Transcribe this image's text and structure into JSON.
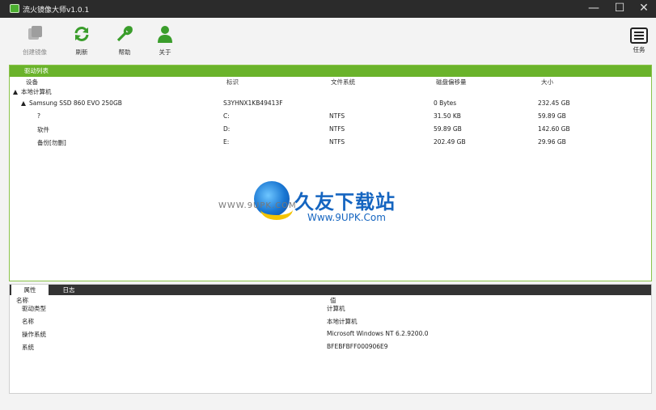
{
  "window": {
    "title": "流火镜像大师v1.0.1",
    "minimize": "—",
    "maximize": "☐",
    "close": "✕"
  },
  "toolbar": {
    "create_image": "创建镜像",
    "refresh": "刷新",
    "help": "帮助",
    "about": "关于",
    "tasks": "任务"
  },
  "drives": {
    "panel_title": "驱动列表",
    "columns": {
      "device": "设备",
      "label": "标识",
      "filesystem": "文件系统",
      "free": "磁盘偏移量",
      "size": "大小"
    },
    "computer": "本地计算机",
    "disk": {
      "name": "Samsung SSD 860 EVO 250GB",
      "label": "S3YHNX1KB49413F",
      "filesystem": "",
      "free": "0 Bytes",
      "size": "232.45 GB"
    },
    "partitions": [
      {
        "name": "?",
        "label": "C:",
        "filesystem": "NTFS",
        "free": "31.50 KB",
        "size": "59.89 GB"
      },
      {
        "name": "软件",
        "label": "D:",
        "filesystem": "NTFS",
        "free": "59.89 GB",
        "size": "142.60 GB"
      },
      {
        "name": "备份[勿删]",
        "label": "E:",
        "filesystem": "NTFS",
        "free": "202.49 GB",
        "size": "29.96 GB"
      }
    ]
  },
  "watermark": {
    "url": "WWW.9UPK.COM",
    "brand_cn": "久友下载站",
    "brand_en": "Www.9UPK.Com"
  },
  "properties": {
    "tabs": [
      "属性",
      "日志"
    ],
    "columns": {
      "name": "名称",
      "value": "值"
    },
    "rows": [
      {
        "name": "驱动类型",
        "value": "计算机"
      },
      {
        "name": "名称",
        "value": "本地计算机"
      },
      {
        "name": "操作系统",
        "value": "Microsoft Windows NT 6.2.9200.0"
      },
      {
        "name": "系统",
        "value": "BFEBFBFF000906E9"
      }
    ]
  },
  "colors": {
    "accent_green": "#6ab32b",
    "titlebar": "#2b2b2b",
    "refresh_icon": "#3a9d2b"
  }
}
